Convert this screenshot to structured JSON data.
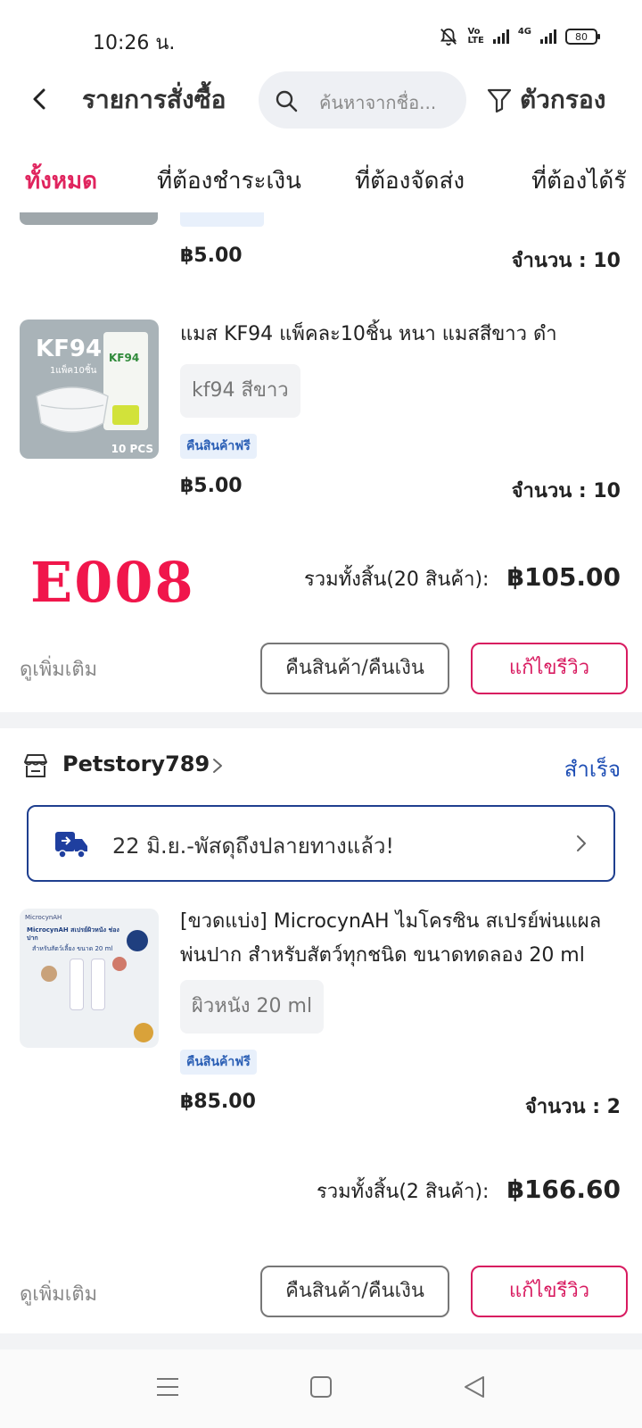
{
  "status_bar": {
    "time": "10:26 น.",
    "battery": "80",
    "network": "4G"
  },
  "header": {
    "title": "รายการสั่งซื้อ",
    "search_placeholder": "ค้นหาจากชื่อ...",
    "filter_label": "ตัวกรอง"
  },
  "tabs": [
    {
      "label": "ทั้งหมด",
      "active": true
    },
    {
      "label": "ที่ต้องชำระเงิน",
      "active": false
    },
    {
      "label": "ที่ต้องจัดส่ง",
      "active": false
    },
    {
      "label": "ที่ต้องได้รั",
      "active": false
    }
  ],
  "order1": {
    "prev_item": {
      "price": "฿5.00",
      "qty": "จำนวน : 10"
    },
    "item": {
      "thumb_title": "KF94",
      "thumb_sub": "1แพ็ค10ชิ้น",
      "thumb_pack": "KF94",
      "thumb_count": "10 PCS",
      "name": "แมส KF94 แพ็คละ10ชิ้น หนา แมสสีขาว ดำ",
      "variant": "kf94  สีขาว",
      "badge": "คืนสินค้าฟรี",
      "price": "฿5.00",
      "qty": "จำนวน : 10"
    },
    "stamp": "E008",
    "total_label": "รวมทั้งสิ้น(20 สินค้า):",
    "total_value": "฿105.00",
    "more": "ดูเพิ่มเติม",
    "return_button": "คืนสินค้า/คืนเงิน",
    "review_button": "แก้ไขรีวิว"
  },
  "order2": {
    "shop_name": "Petstory789",
    "status": "สำเร็จ",
    "delivery": "22 มิ.ย.-พัสดุถึงปลายทางแล้ว!",
    "item": {
      "thumb_brand": "MicrocynAH",
      "thumb_title": "MicrocynAH สเปรย์ผิวหนัง ช่องปาก",
      "thumb_sub": "สำหรับสัตว์เลี้ยง ขนาด 20 ml",
      "name": "[ขวดแบ่ง] MicrocynAH ไมโครซิน สเปรย์พ่นแผล พ่นปาก สำหรับสัตว์ทุกชนิด ขนาดทดลอง 20 ml",
      "variant": "ผิวหนัง 20 ml",
      "badge": "คืนสินค้าฟรี",
      "price": "฿85.00",
      "qty": "จำนวน : 2"
    },
    "total_label": "รวมทั้งสิ้น(2 สินค้า):",
    "total_value": "฿166.60",
    "more": "ดูเพิ่มเติม",
    "return_button": "คืนสินค้า/คืนเงิน",
    "review_button": "แก้ไขรีวิว"
  },
  "colors": {
    "accent": "#e0245e",
    "review_border": "#d81b60",
    "link_blue": "#1f4fb5",
    "badge_bg": "#e8f0fb"
  }
}
